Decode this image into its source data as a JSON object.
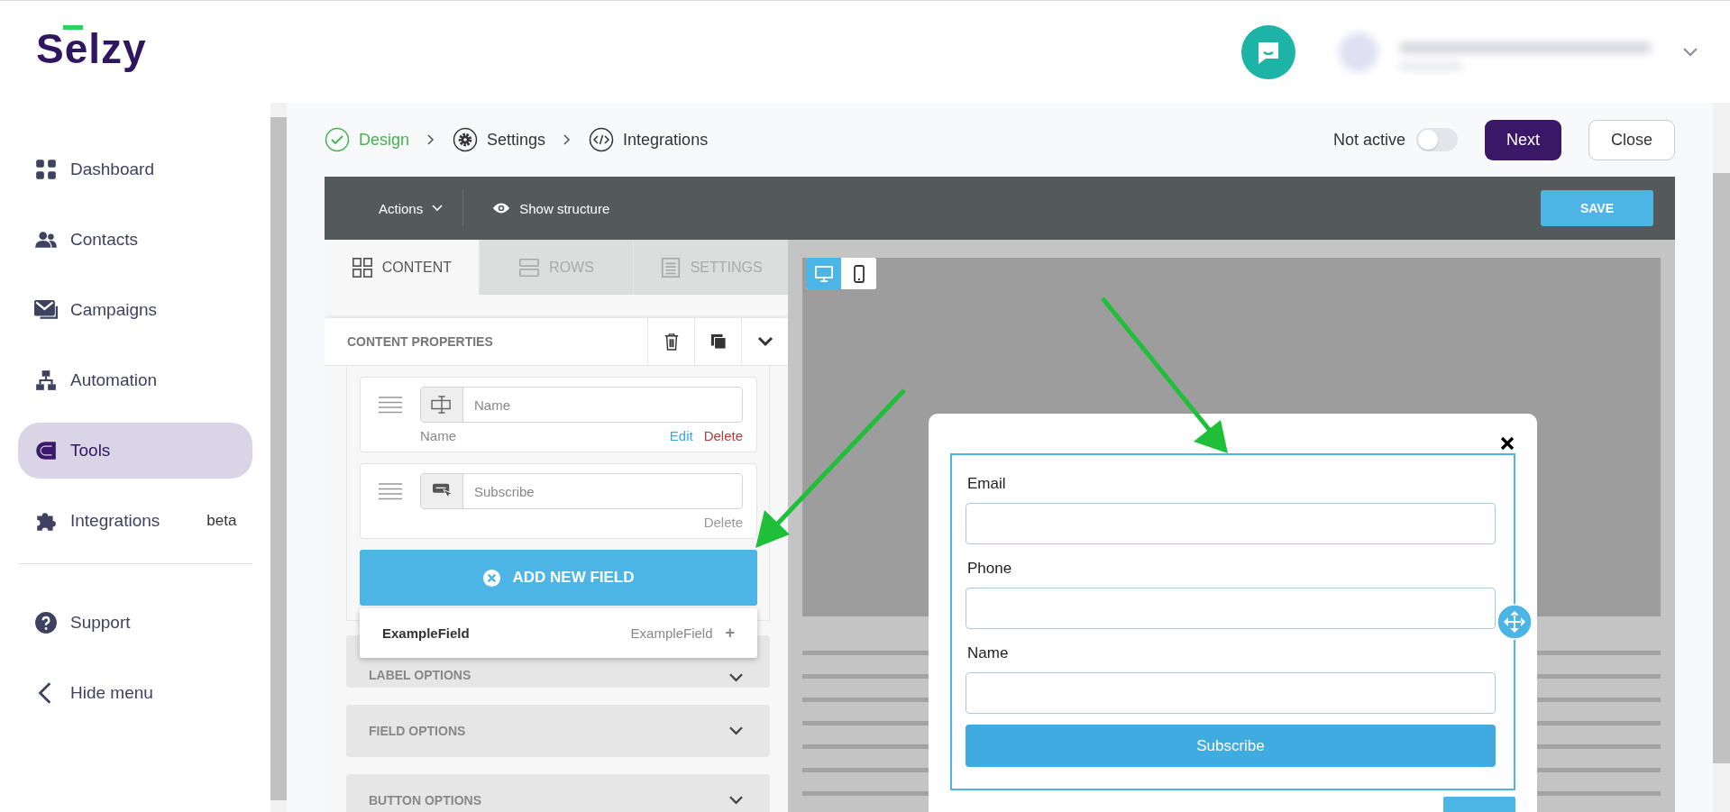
{
  "header": {
    "logo": "Selzy"
  },
  "sidebar": {
    "items": [
      {
        "label": "Dashboard",
        "selected": false
      },
      {
        "label": "Contacts",
        "selected": false
      },
      {
        "label": "Campaigns",
        "selected": false
      },
      {
        "label": "Automation",
        "selected": false
      },
      {
        "label": "Tools",
        "selected": true
      },
      {
        "label": "Integrations",
        "selected": false,
        "badge": "beta"
      }
    ],
    "footer": [
      {
        "label": "Support",
        "kind": "help"
      },
      {
        "label": "Hide menu",
        "kind": "collapse"
      }
    ]
  },
  "steps": [
    {
      "label": "Design",
      "done": true
    },
    {
      "label": "Settings",
      "done": false
    },
    {
      "label": "Integrations",
      "done": false
    }
  ],
  "status": {
    "label": "Not active",
    "on": false
  },
  "actions": [
    {
      "label": "Next",
      "kind": "primary"
    },
    {
      "label": "Close",
      "kind": "secondary"
    }
  ],
  "toolbar": {
    "menu": "Actions",
    "structure": "Show structure",
    "save": "SAVE"
  },
  "tabs": [
    {
      "label": "CONTENT",
      "selected": true
    },
    {
      "label": "ROWS",
      "selected": false
    },
    {
      "label": "SETTINGS",
      "selected": false
    }
  ],
  "properties": {
    "title": "CONTENT PROPERTIES",
    "fields": [
      {
        "value": "Name",
        "caption": "Name",
        "links": [
          {
            "label": "Edit",
            "kind": "edit",
            "disabled": false
          },
          {
            "label": "Delete",
            "kind": "delete",
            "disabled": false
          }
        ]
      },
      {
        "value": "Subscribe",
        "links": [
          {
            "label": "Delete",
            "kind": "delete",
            "disabled": true
          }
        ]
      }
    ],
    "add": "ADD NEW FIELD",
    "suggestions": [
      {
        "label": "ExampleField",
        "type": "ExampleField",
        "add": "+"
      }
    ],
    "sections": [
      "LABEL OPTIONS",
      "FIELD OPTIONS",
      "BUTTON OPTIONS"
    ]
  },
  "views": [
    {
      "kind": "desktop",
      "selected": true
    },
    {
      "kind": "mobile",
      "selected": false
    }
  ],
  "form": {
    "fields": [
      "Email",
      "Phone",
      "Name"
    ],
    "submit": "Subscribe"
  }
}
